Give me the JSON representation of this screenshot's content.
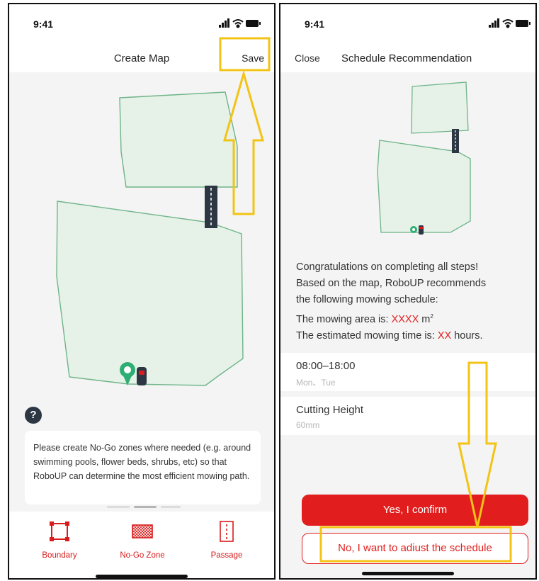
{
  "left_screen": {
    "status": {
      "time": "9:41"
    },
    "nav": {
      "title": "Create Map",
      "save_label": "Save"
    },
    "help_label": "?",
    "tip_text": "Please create No-Go zones where needed (e.g. around swimming pools, flower beds, shrubs, etc) so that  RoboUP can determine the most efficient mowing path.",
    "toolbar": [
      {
        "label": "Boundary",
        "icon": "boundary-icon"
      },
      {
        "label": "No-Go Zone",
        "icon": "no-go-zone-icon"
      },
      {
        "label": "Passage",
        "icon": "passage-icon"
      }
    ]
  },
  "right_screen": {
    "status": {
      "time": "9:41"
    },
    "nav": {
      "close_label": "Close",
      "title": "Schedule Recommendation"
    },
    "congrats": {
      "line1": "Congratulations on completing all steps!",
      "line2": "Based on the map, RoboUP recommends",
      "line3": "the following mowing schedule:",
      "area_prefix": "The mowing area is: ",
      "area_value": "XXXX",
      "area_unit": " m",
      "area_sup": "2",
      "time_prefix": "The estimated mowing time is: ",
      "time_value": "XX",
      "time_suffix": " hours."
    },
    "schedule": {
      "time_range": "08:00–18:00",
      "days": "Mon、Tue"
    },
    "cutting": {
      "label": "Cutting Height",
      "value": "60mm"
    },
    "buttons": {
      "confirm": "Yes, I confirm",
      "adjust": "No, I want to adiust the schedule"
    }
  },
  "colors": {
    "accent_red": "#e21d1d",
    "annotation_yellow": "#f3c316",
    "lawn_fill": "#e6f2e8",
    "lawn_stroke": "#6fb489",
    "passage_dark": "#2d3744"
  }
}
